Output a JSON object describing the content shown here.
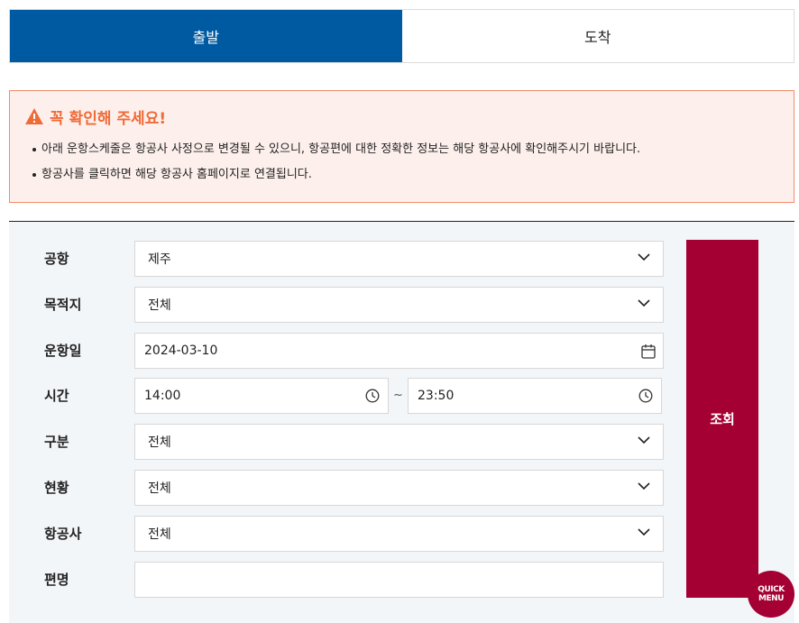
{
  "tabs": [
    {
      "label": "출발",
      "active": true
    },
    {
      "label": "도착",
      "active": false
    }
  ],
  "notice": {
    "title": "꼭 확인해 주세요!",
    "items": [
      "아래 운항스케줄은 항공사 사정으로 변경될 수 있으니, 항공편에 대한 정확한 정보는 해당 항공사에 확인해주시기 바랍니다.",
      "항공사를 클릭하면 해당 항공사 홈페이지로 연결됩니다."
    ]
  },
  "form": {
    "airport": {
      "label": "공항",
      "value": "제주"
    },
    "destination": {
      "label": "목적지",
      "value": "전체"
    },
    "date": {
      "label": "운항일",
      "value": "2024-03-10"
    },
    "time": {
      "label": "시간",
      "from": "14:00",
      "to": "23:50",
      "separator": "~"
    },
    "category": {
      "label": "구분",
      "value": "전체"
    },
    "status": {
      "label": "현황",
      "value": "전체"
    },
    "airline": {
      "label": "항공사",
      "value": "전체"
    },
    "flight": {
      "label": "편명",
      "value": ""
    }
  },
  "submit_label": "조회",
  "quick_menu": {
    "line1": "QUICK",
    "line2": "MENU"
  },
  "colors": {
    "tab_active": "#005aa2",
    "notice_accent": "#ef6b38",
    "submit": "#a50034"
  }
}
